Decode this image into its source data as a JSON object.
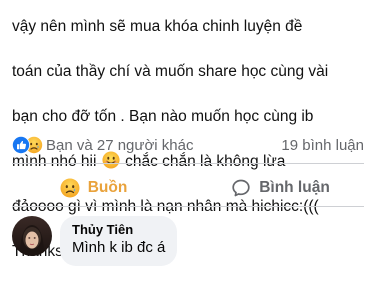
{
  "post": {
    "lines": [
      "vậy nên mình sẽ mua khóa chinh luyện đề",
      "toán  của thầy chí và muốn share học cùng vài",
      "bạn cho đỡ tốn . Bạn nào muốn học cùng ib",
      "mình nhó hii",
      "chắc chắn là không lừa",
      "đảoooo gì vì mình là nạn nhân mà hichicc:(((",
      "Thanks youuu"
    ],
    "inline_emoji": "smiling-face-emoji"
  },
  "reactions": {
    "icons": [
      "like-reaction-icon",
      "sad-reaction-icon"
    ],
    "summary": "Bạn và 27 người khác",
    "comments_count": "19 bình luận"
  },
  "actions": {
    "sad_label": "Buồn",
    "comment_label": "Bình luận"
  },
  "comment": {
    "author": "Thủy Tiên",
    "text": "Mình k ib đc á"
  },
  "colors": {
    "like_blue": "#1877f2",
    "sad_yellow": "#f7b125",
    "sad_label": "#e9a23b",
    "muted": "#65676b",
    "bubble_bg": "#f0f2f5"
  }
}
